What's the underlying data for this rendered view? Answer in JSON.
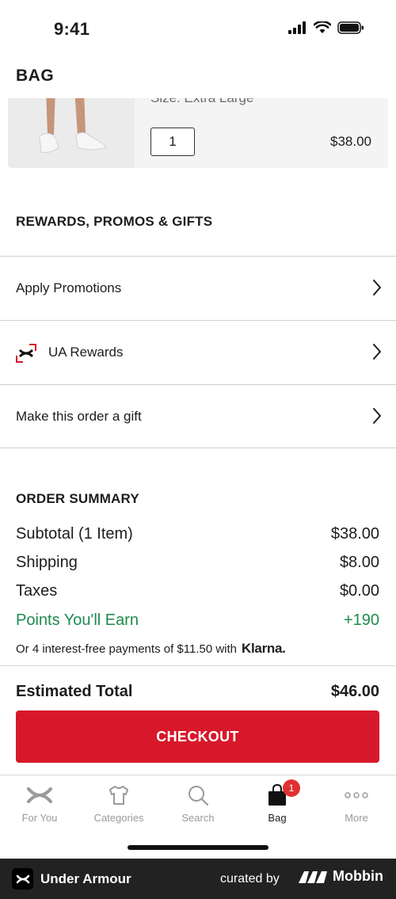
{
  "status_bar": {
    "time": "9:41"
  },
  "header": {
    "title": "BAG"
  },
  "product": {
    "size_text": "Size: Extra Large",
    "quantity": "1",
    "price": "$38.00"
  },
  "rewards": {
    "heading": "REWARDS, PROMOS & GIFTS",
    "rows": [
      {
        "label": "Apply Promotions",
        "icon": "chevron-right-icon"
      },
      {
        "label": "UA Rewards",
        "icon": "ua-rewards-icon"
      },
      {
        "label": "Make this order a gift",
        "icon": "chevron-right-icon"
      }
    ]
  },
  "summary": {
    "heading": "ORDER SUMMARY",
    "lines": [
      {
        "label": "Subtotal (1 Item)",
        "value": "$38.00"
      },
      {
        "label": "Shipping",
        "value": "$8.00"
      },
      {
        "label": "Taxes",
        "value": "$0.00"
      },
      {
        "label": "Points You'll Earn",
        "value": "+190"
      }
    ],
    "klarna_text": "Or 4 interest-free payments of $11.50 with",
    "klarna_brand": "Klarna.",
    "estimated_label": "Estimated Total",
    "estimated_value": "$46.00"
  },
  "checkout": {
    "label": "CHECKOUT"
  },
  "tabs": [
    {
      "label": "For You",
      "icon": "ua-logo-icon"
    },
    {
      "label": "Categories",
      "icon": "shirt-icon"
    },
    {
      "label": "Search",
      "icon": "search-icon"
    },
    {
      "label": "Bag",
      "icon": "bag-icon",
      "badge": "1",
      "active": true
    },
    {
      "label": "More",
      "icon": "more-icon"
    }
  ],
  "footer": {
    "app_name": "Under Armour",
    "curated_by": "curated by",
    "brand": "Mobbin"
  },
  "colors": {
    "accent": "#d7182a",
    "points": "#1f8a4c",
    "badge": "#e03131"
  }
}
